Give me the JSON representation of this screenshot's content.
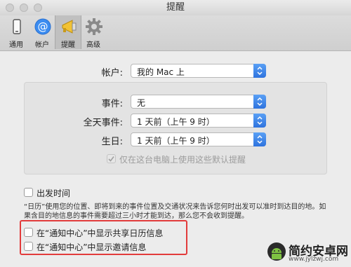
{
  "window": {
    "title": "提醒"
  },
  "toolbar": {
    "items": [
      {
        "label": "通用",
        "icon": "phone-icon"
      },
      {
        "label": "帐户",
        "icon": "at-sign-icon"
      },
      {
        "label": "提醒",
        "icon": "megaphone-icon"
      },
      {
        "label": "高级",
        "icon": "gear-icon"
      }
    ],
    "selected": "提醒"
  },
  "account": {
    "label": "帐户:",
    "value": "我的 Mac 上"
  },
  "defaults": {
    "event": {
      "label": "事件:",
      "value": "无"
    },
    "all_day": {
      "label": "全天事件:",
      "value": "1 天前（上午 9 时）"
    },
    "birthday": {
      "label": "生日:",
      "value": "1 天前（上午 9 时）"
    },
    "only_this_mac": {
      "label": "仅在这台电脑上使用这些默认提醒",
      "checked": true,
      "disabled": true
    }
  },
  "time_to_leave": {
    "label": "出发时间",
    "checked": false,
    "description": "“日历”使用您的位置、即将到来的事件位置及交通状况来告诉您何时出发可以准时到达目的地。如果含目的地信息的事件需要超过三小时才能到达，那么您不会收到提醒。"
  },
  "shared_calendar": {
    "label": "在“通知中心”中显示共享日历信息",
    "checked": false
  },
  "invitations": {
    "label": "在“通知中心”中显示邀请信息",
    "checked": false
  },
  "watermark": {
    "text": "简约安卓网",
    "url": "www.jylzwj.com"
  },
  "colors": {
    "accent": "#2e73de",
    "highlight": "#e23b3b"
  }
}
